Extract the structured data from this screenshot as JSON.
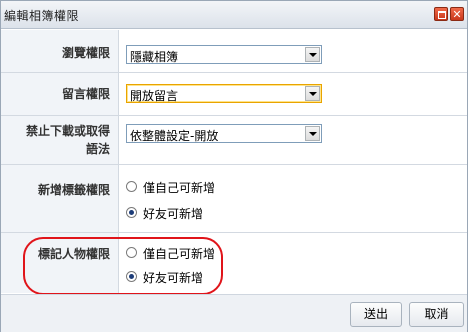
{
  "window": {
    "title": "編輯相簿權限"
  },
  "fields": {
    "browse": {
      "label": "瀏覽權限",
      "value": "隱藏相簿"
    },
    "comment": {
      "label": "留言權限",
      "value": "開放留言"
    },
    "download": {
      "label_line1": "禁止下載或取得",
      "label_line2": "語法",
      "value": "依整體設定-開放"
    },
    "tag": {
      "label": "新增標籤權限",
      "options": [
        "僅自己可新增",
        "好友可新增"
      ],
      "selected": 1
    },
    "people": {
      "label": "標記人物權限",
      "options": [
        "僅自己可新增",
        "好友可新增"
      ],
      "selected": 1
    }
  },
  "buttons": {
    "send": "送出",
    "cancel": "取消"
  },
  "colors": {
    "highlight_circle": "#e0141a"
  }
}
